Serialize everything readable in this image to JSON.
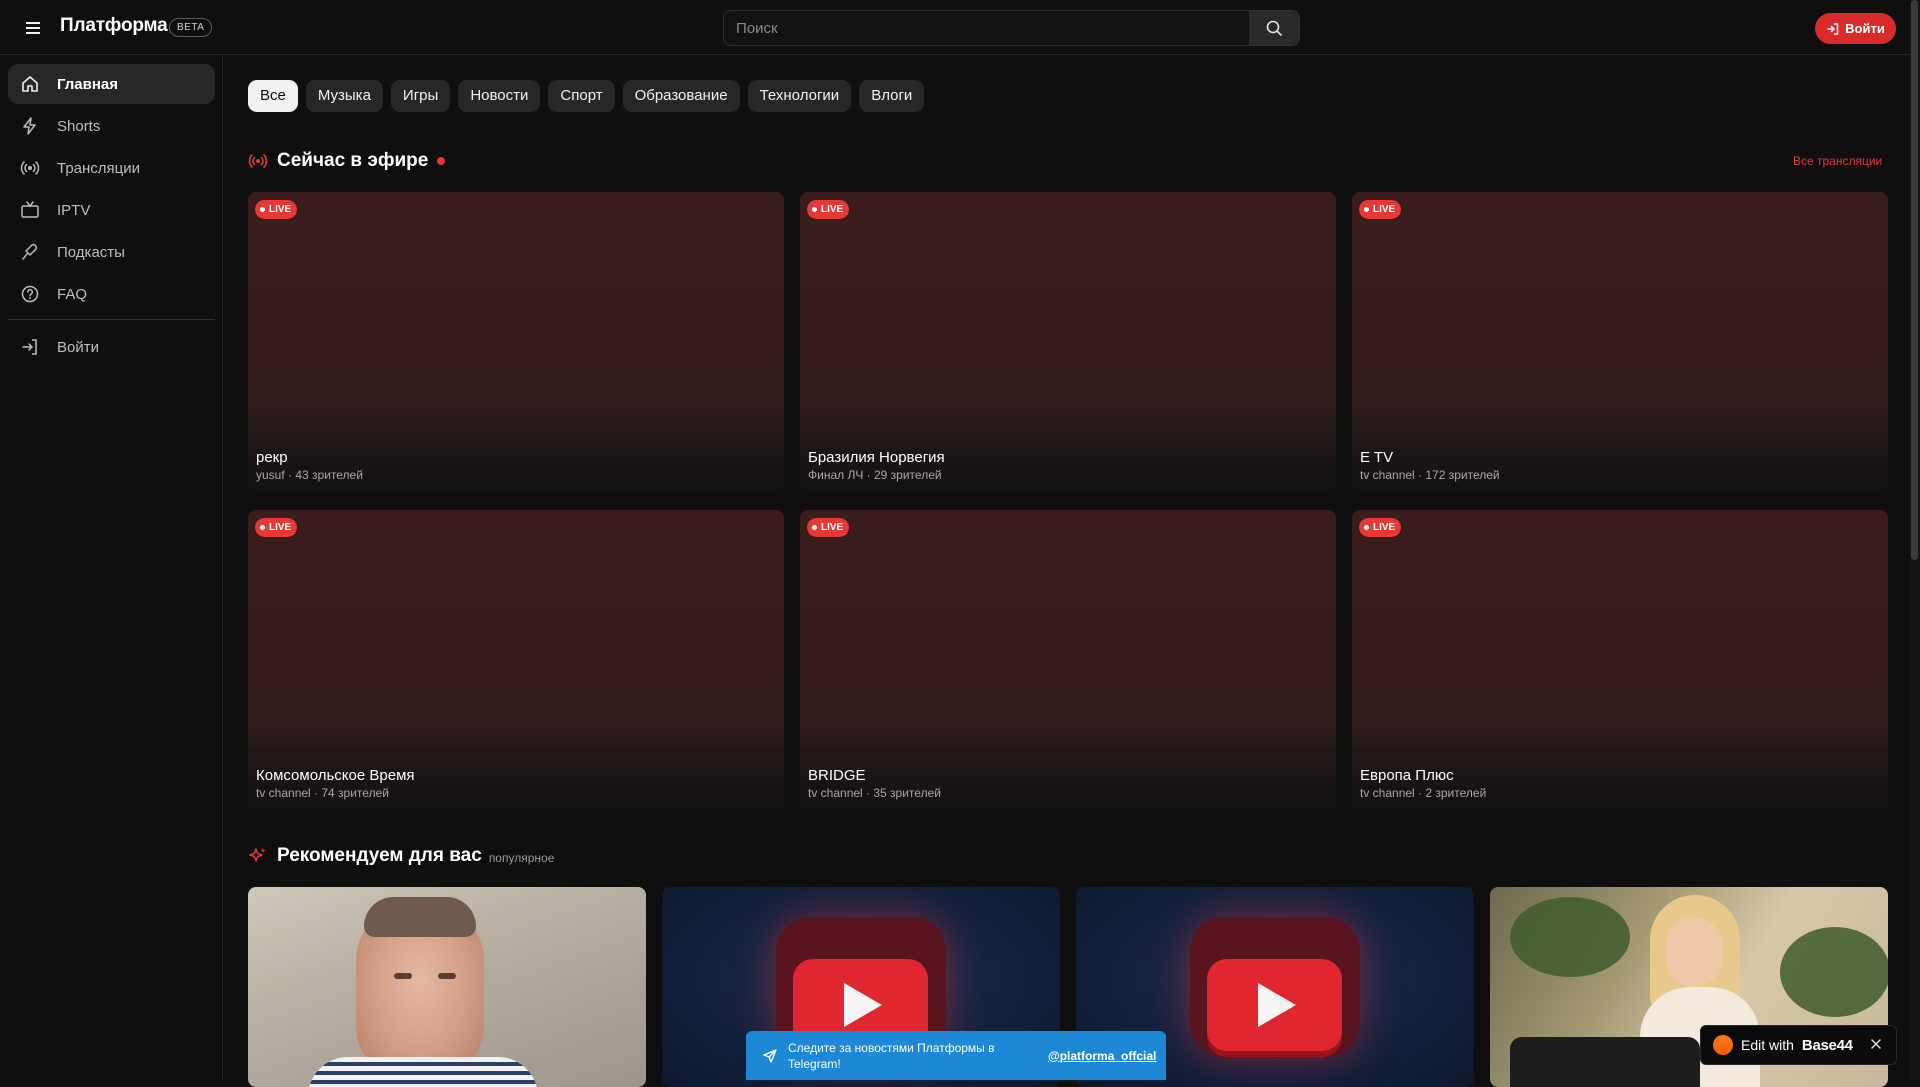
{
  "header": {
    "logo": "Платформа",
    "beta": "BETA",
    "search_placeholder": "Поиск",
    "login_label": "Войти"
  },
  "sidebar": {
    "items": [
      {
        "label": "Главная",
        "icon": "home-icon",
        "active": true
      },
      {
        "label": "Shorts",
        "icon": "bolt-icon",
        "active": false
      },
      {
        "label": "Трансляции",
        "icon": "broadcast-icon",
        "active": false
      },
      {
        "label": "IPTV",
        "icon": "tv-icon",
        "active": false
      },
      {
        "label": "Подкасты",
        "icon": "microphone-icon",
        "active": false
      },
      {
        "label": "FAQ",
        "icon": "help-circle-icon",
        "active": false
      }
    ],
    "login_label": "Войти"
  },
  "chips": [
    "Все",
    "Музыка",
    "Игры",
    "Новости",
    "Спорт",
    "Образование",
    "Технологии",
    "Влоги"
  ],
  "live_section": {
    "title": "Сейчас в эфире",
    "all_link": "Все трансляции",
    "badge": "LIVE",
    "streams": [
      {
        "title": "рекр",
        "meta": "yusuf · 43 зрителей"
      },
      {
        "title": "Бразилия Норвегия",
        "meta": "Финал ЛЧ · 29 зрителей"
      },
      {
        "title": "E TV",
        "meta": "tv channel · 172 зрителей"
      },
      {
        "title": "Комсомольское Время",
        "meta": "tv channel · 74 зрителей"
      },
      {
        "title": "BRIDGE",
        "meta": "tv channel · 35 зрителей"
      },
      {
        "title": "Европа Плюс",
        "meta": "tv channel · 2 зрителей"
      }
    ]
  },
  "recommended_section": {
    "title": "Рекомендуем для вас",
    "subtitle": "популярное"
  },
  "toast": {
    "text": "Следите за новостями Платформы в Telegram!",
    "link": "@platforma_offcial"
  },
  "edit_badge": {
    "text": "Edit with",
    "brand": "Base44"
  },
  "colors": {
    "accent": "#e53935",
    "background": "#0f0f0f",
    "telegram_blue": "#1d88d6"
  }
}
